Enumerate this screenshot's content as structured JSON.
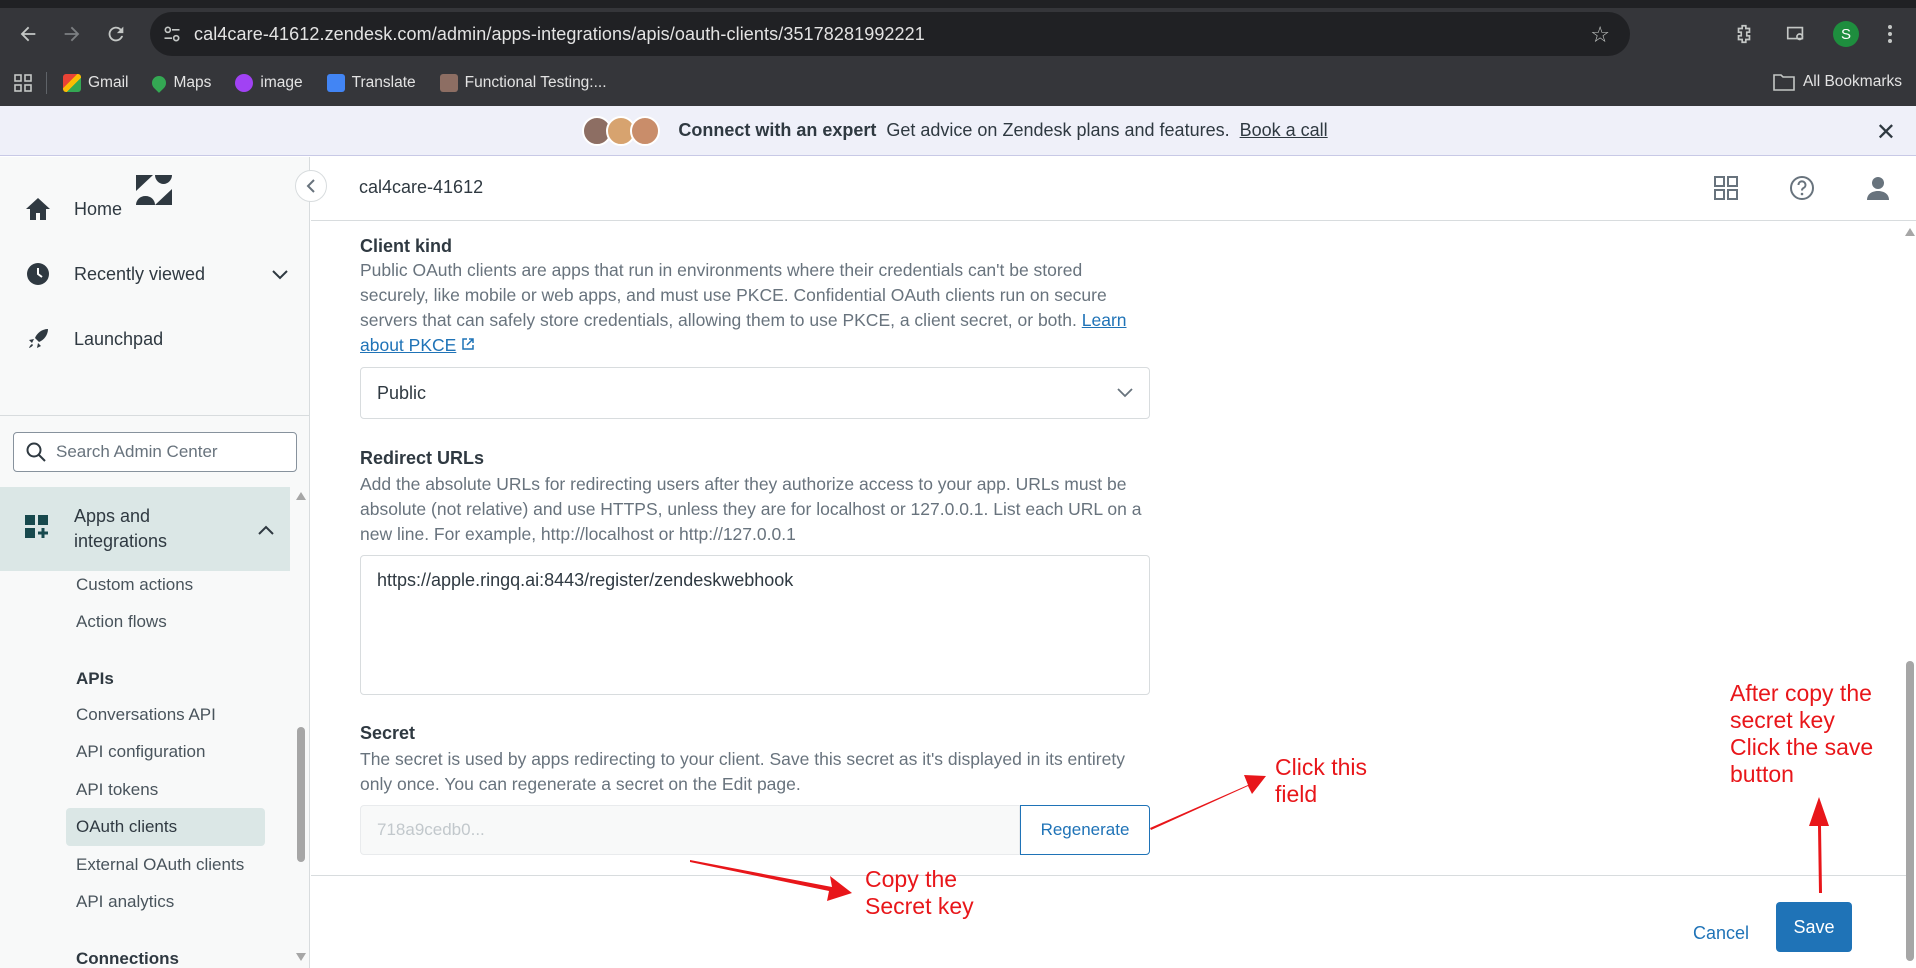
{
  "browser": {
    "url": "cal4care-41612.zendesk.com/admin/apps-integrations/apis/oauth-clients/35178281992221",
    "profile_initial": "S",
    "bookmarks": [
      {
        "label": "Gmail",
        "icon": "gmail-icon",
        "color": "#ea4335"
      },
      {
        "label": "Maps",
        "icon": "maps-icon",
        "color": "#34a853"
      },
      {
        "label": "image",
        "icon": "image-icon",
        "color": "#a142f4"
      },
      {
        "label": "Translate",
        "icon": "translate-icon",
        "color": "#4285f4"
      },
      {
        "label": "Functional Testing:...",
        "icon": "book-icon",
        "color": "#8d6e63"
      }
    ],
    "all_bookmarks": "All Bookmarks"
  },
  "banner": {
    "title": "Connect with an expert",
    "description": "Get advice on Zendesk plans and features.",
    "link": "Book a call"
  },
  "sidebar": {
    "home": "Home",
    "recently_viewed": "Recently viewed",
    "launchpad": "Launchpad",
    "search_placeholder": "Search Admin Center",
    "apps_line1": "Apps and",
    "apps_line2": "integrations",
    "custom_actions": "Custom actions",
    "action_flows": "Action flows",
    "apis_heading": "APIs",
    "conversations_api": "Conversations API",
    "api_configuration": "API configuration",
    "api_tokens": "API tokens",
    "oauth_clients": "OAuth clients",
    "external_oauth_clients": "External OAuth clients",
    "api_analytics": "API analytics",
    "connections_heading": "Connections"
  },
  "header": {
    "account": "cal4care-41612"
  },
  "form": {
    "client_kind": {
      "label": "Client kind",
      "hint": "Public OAuth clients are apps that run in environments where their credentials can't be stored securely, like mobile or web apps, and must use PKCE. Confidential OAuth clients run on secure servers that can safely store credentials, allowing them to use PKCE, a client secret, or both.",
      "link_part1": "Learn",
      "link_part2": "about PKCE",
      "value": "Public"
    },
    "redirect_urls": {
      "label": "Redirect URLs",
      "hint": "Add the absolute URLs for redirecting users after they authorize access to your app. URLs must be absolute (not relative) and use HTTPS, unless they are for localhost or 127.0.0.1. List each URL on a new line. For example, http://localhost or http://127.0.0.1",
      "value": "https://apple.ringq.ai:8443/register/zendeskwebhook"
    },
    "secret": {
      "label": "Secret",
      "hint": "The secret is used by apps redirecting to your client. Save this secret as it's displayed in its entirety only once. You can regenerate a secret on the Edit page.",
      "value": "718a9cedb0...",
      "regenerate": "Regenerate"
    }
  },
  "footer": {
    "cancel": "Cancel",
    "save": "Save"
  },
  "annotations": {
    "click_field_1": "Click this",
    "click_field_2": "field",
    "copy_secret_1": "Copy the",
    "copy_secret_2": "Secret key",
    "after_copy_1": "After copy the",
    "after_copy_2": "secret key",
    "after_copy_3": "Click the save",
    "after_copy_4": "button",
    "color": "#e8161a"
  }
}
